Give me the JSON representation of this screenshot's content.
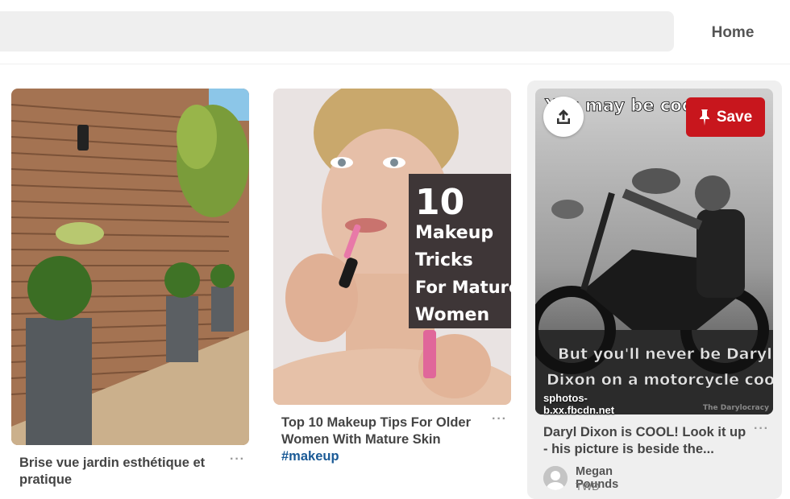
{
  "header": {
    "search_placeholder": "",
    "home_label": "Home"
  },
  "pins": [
    {
      "title": "Brise vue jardin esthétique et pratique",
      "more_label": "···"
    },
    {
      "title_prefix": "Top 10 Makeup Tips For Older Women With Mature Skin ",
      "hashtag": "#makeup",
      "more_label": "···",
      "image_text": {
        "line1": "10",
        "line2": "Makeup",
        "line3": "Tricks",
        "line4": "For Mature",
        "line5": "Women"
      }
    },
    {
      "title": "Daryl Dixon is COOL! Look it up - his picture is beside the...",
      "more_label": "···",
      "save_label": "Save",
      "domain": "sphotos-b.xx.fbcdn.net",
      "image_text": {
        "top": "You may be cool",
        "bottom1": "But you'll never be Daryl",
        "bottom2": "Dixon on a motorcycle cool",
        "watermark": "The Darylocracy"
      },
      "pinner": {
        "name": "Megan Pounds",
        "board": "TWD"
      }
    }
  ],
  "colors": {
    "save_red": "#c8161d",
    "search_bg": "#efefef",
    "hashtag_blue": "#1a5a96"
  }
}
